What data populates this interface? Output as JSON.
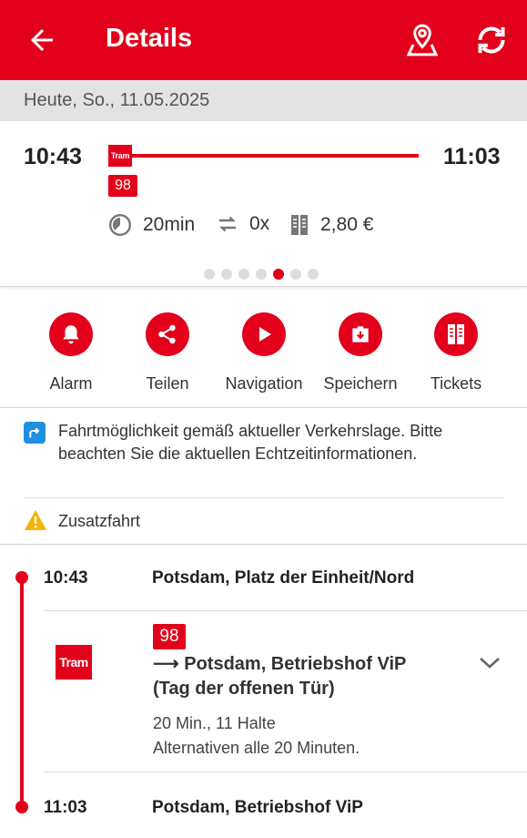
{
  "appbar": {
    "title": "Details",
    "icons": [
      "arrow-left-icon",
      "map-pin-icon",
      "refresh-icon"
    ],
    "color": "#e2001a"
  },
  "date": "Heute, So., 11.05.2025",
  "summary": {
    "departure": "10:43",
    "arrival": "11:03",
    "mode_logo": "Tram",
    "line": "98",
    "duration": "20min",
    "transfers": "0x",
    "price": "2,80 €",
    "page_count": 7,
    "active_page": 5
  },
  "actions": [
    {
      "label": "Alarm",
      "icon": "bell-icon"
    },
    {
      "label": "Teilen",
      "icon": "share-icon"
    },
    {
      "label": "Navigation",
      "icon": "play-icon"
    },
    {
      "label": "Speichern",
      "icon": "save-case-icon"
    },
    {
      "label": "Tickets",
      "icon": "ticket-icon"
    }
  ],
  "notices": {
    "realtime": "Fahrtmöglichkeit gemäß aktueller Verkehrslage. Bitte beachten Sie die aktuellen Echtzeitinformationen.",
    "extra": "Zusatzfahrt"
  },
  "journey": {
    "start": {
      "time": "10:43",
      "stop": "Potsdam, Platz der Einheit/Nord"
    },
    "leg": {
      "mode_logo": "Tram",
      "line": "98",
      "direction_line1": "⟶ Potsdam, Betriebshof ViP",
      "direction_line2": "(Tag der offenen Tür)",
      "meta": "20 Min., 11 Halte",
      "frequency": "Alternativen alle 20 Minuten."
    },
    "end": {
      "time": "11:03",
      "stop": "Potsdam, Betriebshof ViP"
    }
  }
}
